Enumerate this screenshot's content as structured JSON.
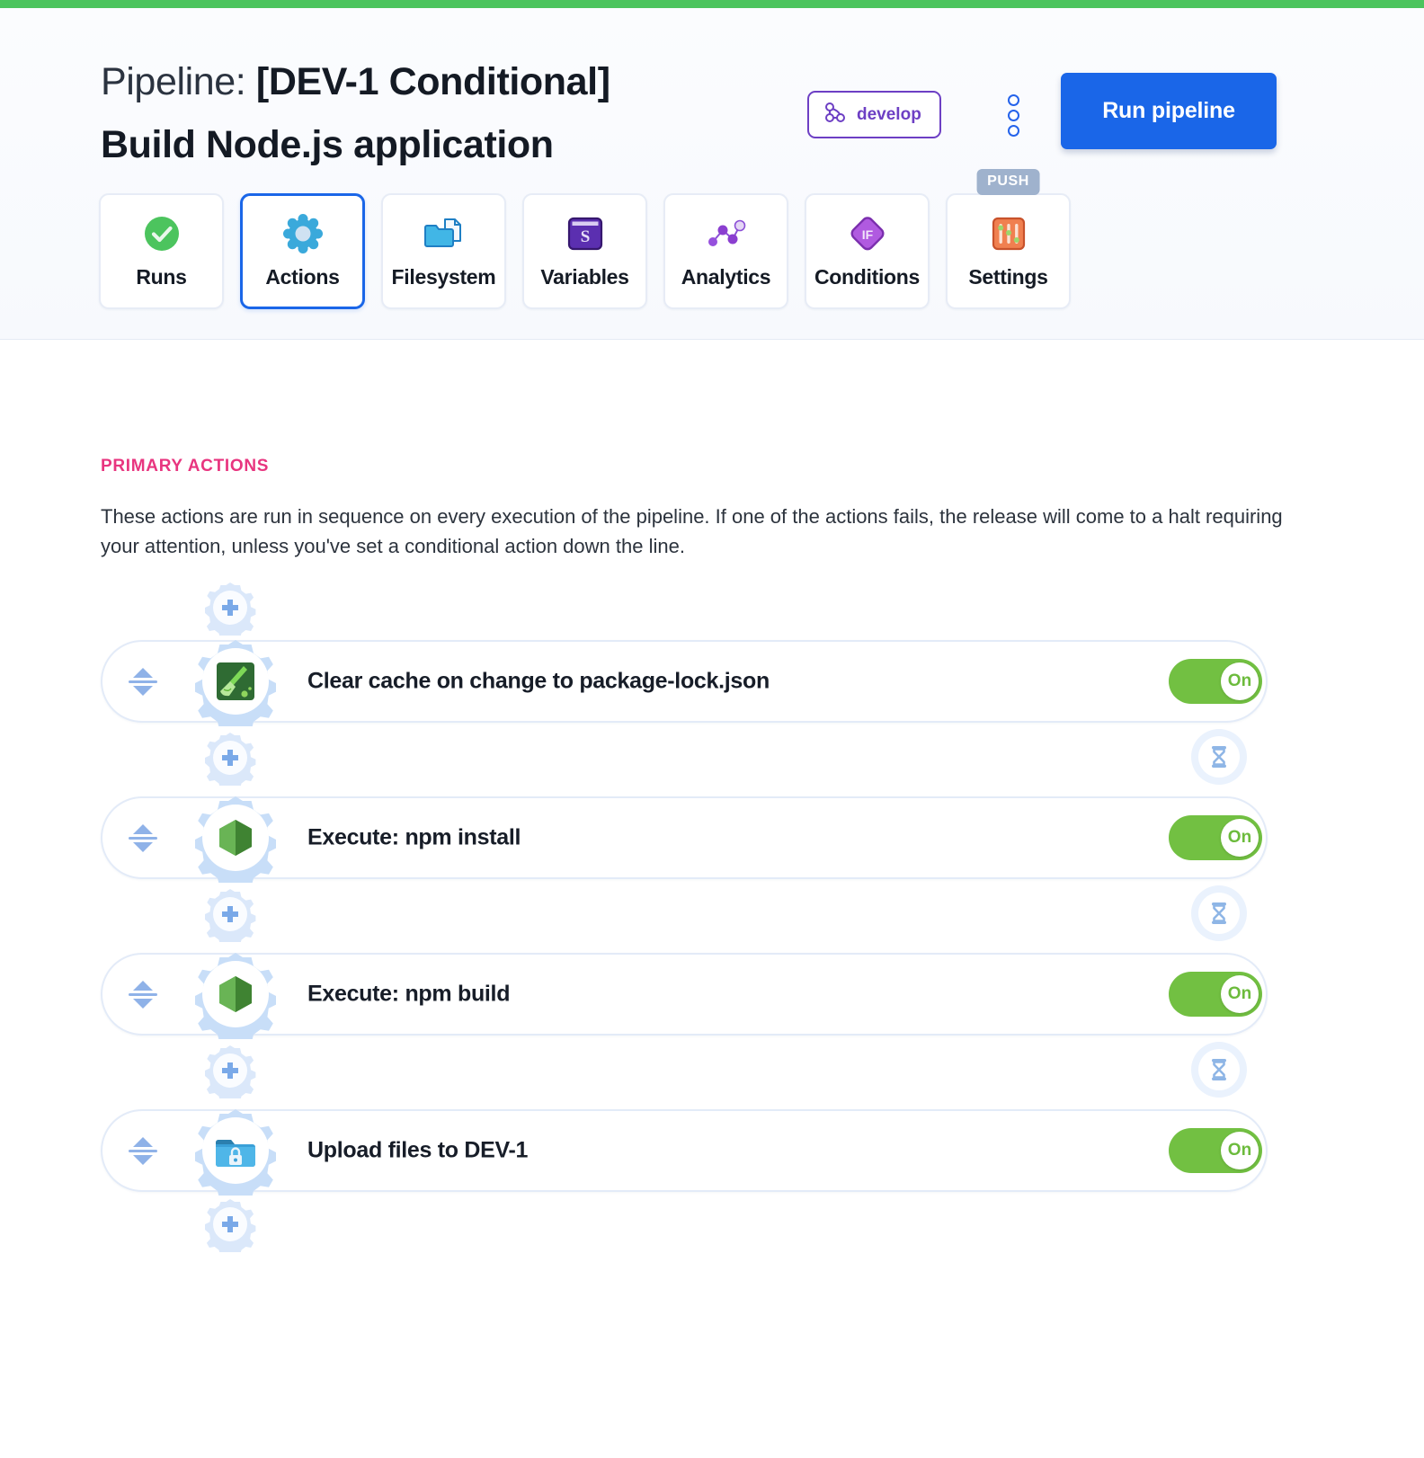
{
  "topbar": {
    "color": "#4cc45e"
  },
  "header": {
    "title_prefix": "Pipeline: ",
    "title_bracket": "[DEV-1 Conditional]",
    "title_second": "Build Node.js application",
    "branch": {
      "label": "develop",
      "icon": "branch-icon",
      "color": "#6d3fc4"
    },
    "kebab_icon": "more-options-icon",
    "run_button": {
      "label": "Run pipeline",
      "color": "#1a66e8"
    }
  },
  "tabs": [
    {
      "label": "Runs",
      "icon": "check-circle-icon",
      "active": false,
      "badge": ""
    },
    {
      "label": "Actions",
      "icon": "gear-flower-icon",
      "active": true,
      "badge": ""
    },
    {
      "label": "Filesystem",
      "icon": "folder-file-icon",
      "active": false,
      "badge": ""
    },
    {
      "label": "Variables",
      "icon": "dollar-window-icon",
      "active": false,
      "badge": ""
    },
    {
      "label": "Analytics",
      "icon": "graph-nodes-icon",
      "active": false,
      "badge": ""
    },
    {
      "label": "Conditions",
      "icon": "if-diamond-icon",
      "active": false,
      "badge": ""
    },
    {
      "label": "Settings",
      "icon": "sliders-icon",
      "active": false,
      "badge": "PUSH"
    }
  ],
  "main": {
    "section_label": "PRIMARY ACTIONS",
    "section_label_color": "#e8357f",
    "section_description": "These actions are run in sequence on every execution of the pipeline. If one of the actions fails, the release will come to a halt requiring your attention, unless you've set a conditional action down the line.",
    "add_action_icon": "gear-plus-icon",
    "timer_icon": "hourglass-icon",
    "drag_handle_icon": "drag-updown-icon",
    "actions": [
      {
        "title": "Clear cache on change to package-lock.json",
        "icon": "broom-icon",
        "toggle": "On",
        "toggle_on": true
      },
      {
        "title": "Execute: npm install",
        "icon": "nodejs-icon",
        "toggle": "On",
        "toggle_on": true
      },
      {
        "title": "Execute: npm build",
        "icon": "nodejs-icon",
        "toggle": "On",
        "toggle_on": true
      },
      {
        "title": "Upload files to DEV-1",
        "icon": "folder-lock-icon",
        "toggle": "On",
        "toggle_on": true
      }
    ]
  }
}
